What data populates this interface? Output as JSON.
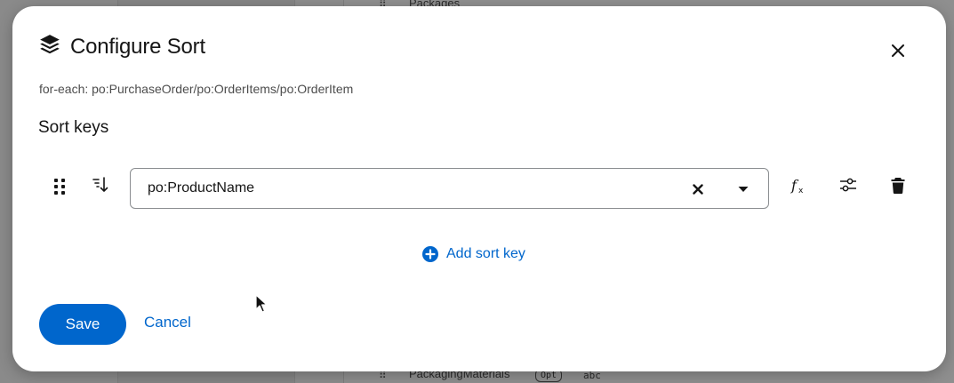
{
  "background": {
    "header_label": "Packages",
    "footer_label": "PackagingMaterials",
    "footer_badge": "Opt",
    "footer_type": "abc"
  },
  "modal": {
    "title": "Configure Sort",
    "subtitle": "for-each: po:PurchaseOrder/po:OrderItems/po:OrderItem",
    "section_title": "Sort keys",
    "sort_keys": [
      {
        "value": "po:ProductName"
      }
    ],
    "add_sort_key_label": "Add sort key",
    "save_label": "Save",
    "cancel_label": "Cancel"
  },
  "icons": {
    "title": "layers-icon",
    "close": "close-icon",
    "drag": "drag-handle-icon",
    "sort_direction": "sort-ascending-icon",
    "clear": "clear-icon",
    "dropdown": "caret-down-icon",
    "function": "function-icon",
    "options": "sliders-icon",
    "delete": "trash-icon",
    "add": "plus-circle-icon"
  },
  "colors": {
    "primary": "#0066cc",
    "text": "#151515",
    "muted_text": "#4d4d4d",
    "border": "#8a8d90"
  }
}
